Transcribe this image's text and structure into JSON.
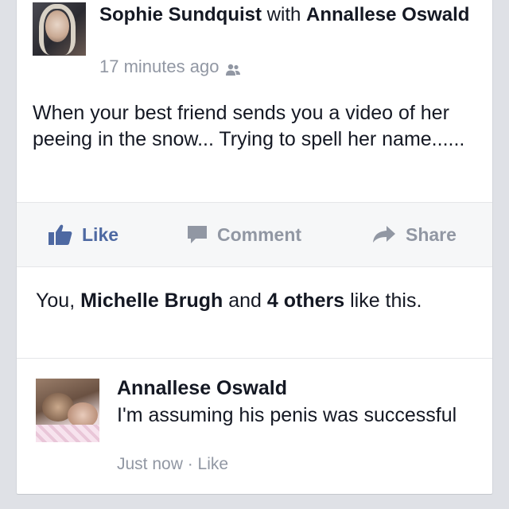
{
  "post": {
    "author": "Sophie Sundquist",
    "with_word": "with",
    "tagged": "Annallese Oswald",
    "timestamp": "17 minutes ago",
    "audience_icon": "friends-icon",
    "text": "When your best friend sends you a video of her peeing in the snow... Trying to spell her name......"
  },
  "actions": {
    "like": "Like",
    "comment": "Comment",
    "share": "Share"
  },
  "likes": {
    "prefix": "You, ",
    "name": "Michelle Brugh",
    "middle": " and ",
    "others": "4 others",
    "suffix": " like this."
  },
  "comment": {
    "author": "Annallese Oswald",
    "text": "I'm assuming his penis was successful",
    "time": "Just now",
    "separator": " · ",
    "like_label": "Like"
  },
  "colors": {
    "accent": "#4e69a2",
    "muted": "#9197a3",
    "text": "#141823"
  }
}
